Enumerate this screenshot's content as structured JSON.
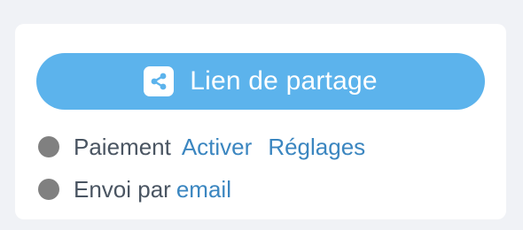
{
  "share": {
    "label": "Lien de partage",
    "icon": "share-icon",
    "color": "#5cb3ec"
  },
  "payment": {
    "label": "Paiement",
    "activate_link": "Activer",
    "settings_link": "Réglages",
    "status_color": "#808080"
  },
  "email": {
    "label": "Envoi par",
    "link": "email",
    "status_color": "#808080"
  },
  "colors": {
    "link": "#3b86c0",
    "text": "#4a5562",
    "background": "#f0f2f6"
  }
}
